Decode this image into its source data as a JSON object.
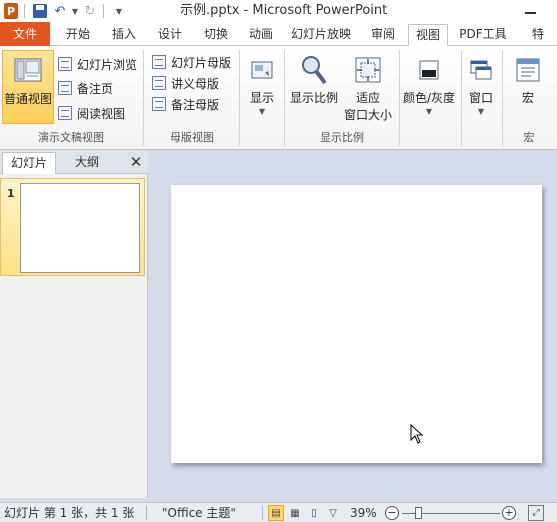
{
  "window": {
    "title": "示例.pptx - Microsoft PowerPoint",
    "app_icon_letter": "P"
  },
  "tabs": [
    {
      "label": "文件",
      "kind": "file"
    },
    {
      "label": "开始"
    },
    {
      "label": "插入"
    },
    {
      "label": "设计"
    },
    {
      "label": "切换"
    },
    {
      "label": "动画"
    },
    {
      "label": "幻灯片放映"
    },
    {
      "label": "审阅"
    },
    {
      "label": "视图",
      "active": true
    },
    {
      "label": "PDF工具"
    },
    {
      "label": "特"
    }
  ],
  "ribbon": {
    "presentation_views": {
      "group_label": "演示文稿视图",
      "normal_view": "普通视图",
      "slide_sorter": "幻灯片浏览",
      "notes_page": "备注页",
      "reading_view": "阅读视图"
    },
    "master_views": {
      "group_label": "母版视图",
      "slide_master": "幻灯片母版",
      "handout_master": "讲义母版",
      "notes_master": "备注母版"
    },
    "show": {
      "label": "显示"
    },
    "zoom": {
      "group_label": "显示比例",
      "zoom_label": "显示比例",
      "fit_line1": "适应",
      "fit_line2": "窗口大小"
    },
    "color": {
      "label": "颜色/灰度"
    },
    "window": {
      "label": "窗口"
    },
    "macros": {
      "group_label": "宏",
      "label": "宏"
    }
  },
  "left_panel": {
    "tab_slides": "幻灯片",
    "tab_outline": "大纲",
    "close_glyph": "✕",
    "slides": [
      {
        "number": "1",
        "selected": true
      }
    ]
  },
  "status_bar": {
    "slide_info": "幻灯片 第 1 张，共 1 张",
    "theme": "\"Office 主题\"",
    "zoom_percent": "39%",
    "zoom_fraction": 0.39
  },
  "colors": {
    "file_tab": "#e3561f",
    "selected_button": "#ffd05a",
    "canvas_bg": "#d6dbe9"
  }
}
